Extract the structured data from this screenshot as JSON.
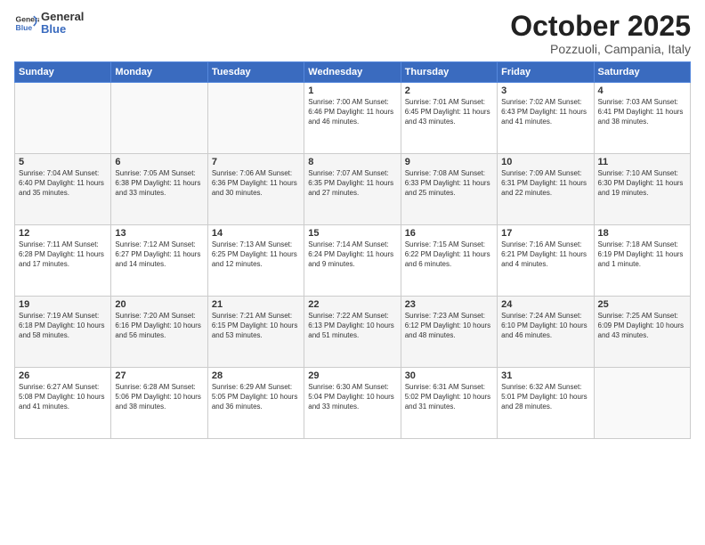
{
  "header": {
    "logo_line1": "General",
    "logo_line2": "Blue",
    "month": "October 2025",
    "location": "Pozzuoli, Campania, Italy"
  },
  "weekdays": [
    "Sunday",
    "Monday",
    "Tuesday",
    "Wednesday",
    "Thursday",
    "Friday",
    "Saturday"
  ],
  "weeks": [
    [
      {
        "day": "",
        "info": ""
      },
      {
        "day": "",
        "info": ""
      },
      {
        "day": "",
        "info": ""
      },
      {
        "day": "1",
        "info": "Sunrise: 7:00 AM\nSunset: 6:46 PM\nDaylight: 11 hours\nand 46 minutes."
      },
      {
        "day": "2",
        "info": "Sunrise: 7:01 AM\nSunset: 6:45 PM\nDaylight: 11 hours\nand 43 minutes."
      },
      {
        "day": "3",
        "info": "Sunrise: 7:02 AM\nSunset: 6:43 PM\nDaylight: 11 hours\nand 41 minutes."
      },
      {
        "day": "4",
        "info": "Sunrise: 7:03 AM\nSunset: 6:41 PM\nDaylight: 11 hours\nand 38 minutes."
      }
    ],
    [
      {
        "day": "5",
        "info": "Sunrise: 7:04 AM\nSunset: 6:40 PM\nDaylight: 11 hours\nand 35 minutes."
      },
      {
        "day": "6",
        "info": "Sunrise: 7:05 AM\nSunset: 6:38 PM\nDaylight: 11 hours\nand 33 minutes."
      },
      {
        "day": "7",
        "info": "Sunrise: 7:06 AM\nSunset: 6:36 PM\nDaylight: 11 hours\nand 30 minutes."
      },
      {
        "day": "8",
        "info": "Sunrise: 7:07 AM\nSunset: 6:35 PM\nDaylight: 11 hours\nand 27 minutes."
      },
      {
        "day": "9",
        "info": "Sunrise: 7:08 AM\nSunset: 6:33 PM\nDaylight: 11 hours\nand 25 minutes."
      },
      {
        "day": "10",
        "info": "Sunrise: 7:09 AM\nSunset: 6:31 PM\nDaylight: 11 hours\nand 22 minutes."
      },
      {
        "day": "11",
        "info": "Sunrise: 7:10 AM\nSunset: 6:30 PM\nDaylight: 11 hours\nand 19 minutes."
      }
    ],
    [
      {
        "day": "12",
        "info": "Sunrise: 7:11 AM\nSunset: 6:28 PM\nDaylight: 11 hours\nand 17 minutes."
      },
      {
        "day": "13",
        "info": "Sunrise: 7:12 AM\nSunset: 6:27 PM\nDaylight: 11 hours\nand 14 minutes."
      },
      {
        "day": "14",
        "info": "Sunrise: 7:13 AM\nSunset: 6:25 PM\nDaylight: 11 hours\nand 12 minutes."
      },
      {
        "day": "15",
        "info": "Sunrise: 7:14 AM\nSunset: 6:24 PM\nDaylight: 11 hours\nand 9 minutes."
      },
      {
        "day": "16",
        "info": "Sunrise: 7:15 AM\nSunset: 6:22 PM\nDaylight: 11 hours\nand 6 minutes."
      },
      {
        "day": "17",
        "info": "Sunrise: 7:16 AM\nSunset: 6:21 PM\nDaylight: 11 hours\nand 4 minutes."
      },
      {
        "day": "18",
        "info": "Sunrise: 7:18 AM\nSunset: 6:19 PM\nDaylight: 11 hours\nand 1 minute."
      }
    ],
    [
      {
        "day": "19",
        "info": "Sunrise: 7:19 AM\nSunset: 6:18 PM\nDaylight: 10 hours\nand 58 minutes."
      },
      {
        "day": "20",
        "info": "Sunrise: 7:20 AM\nSunset: 6:16 PM\nDaylight: 10 hours\nand 56 minutes."
      },
      {
        "day": "21",
        "info": "Sunrise: 7:21 AM\nSunset: 6:15 PM\nDaylight: 10 hours\nand 53 minutes."
      },
      {
        "day": "22",
        "info": "Sunrise: 7:22 AM\nSunset: 6:13 PM\nDaylight: 10 hours\nand 51 minutes."
      },
      {
        "day": "23",
        "info": "Sunrise: 7:23 AM\nSunset: 6:12 PM\nDaylight: 10 hours\nand 48 minutes."
      },
      {
        "day": "24",
        "info": "Sunrise: 7:24 AM\nSunset: 6:10 PM\nDaylight: 10 hours\nand 46 minutes."
      },
      {
        "day": "25",
        "info": "Sunrise: 7:25 AM\nSunset: 6:09 PM\nDaylight: 10 hours\nand 43 minutes."
      }
    ],
    [
      {
        "day": "26",
        "info": "Sunrise: 6:27 AM\nSunset: 5:08 PM\nDaylight: 10 hours\nand 41 minutes."
      },
      {
        "day": "27",
        "info": "Sunrise: 6:28 AM\nSunset: 5:06 PM\nDaylight: 10 hours\nand 38 minutes."
      },
      {
        "day": "28",
        "info": "Sunrise: 6:29 AM\nSunset: 5:05 PM\nDaylight: 10 hours\nand 36 minutes."
      },
      {
        "day": "29",
        "info": "Sunrise: 6:30 AM\nSunset: 5:04 PM\nDaylight: 10 hours\nand 33 minutes."
      },
      {
        "day": "30",
        "info": "Sunrise: 6:31 AM\nSunset: 5:02 PM\nDaylight: 10 hours\nand 31 minutes."
      },
      {
        "day": "31",
        "info": "Sunrise: 6:32 AM\nSunset: 5:01 PM\nDaylight: 10 hours\nand 28 minutes."
      },
      {
        "day": "",
        "info": ""
      }
    ]
  ]
}
